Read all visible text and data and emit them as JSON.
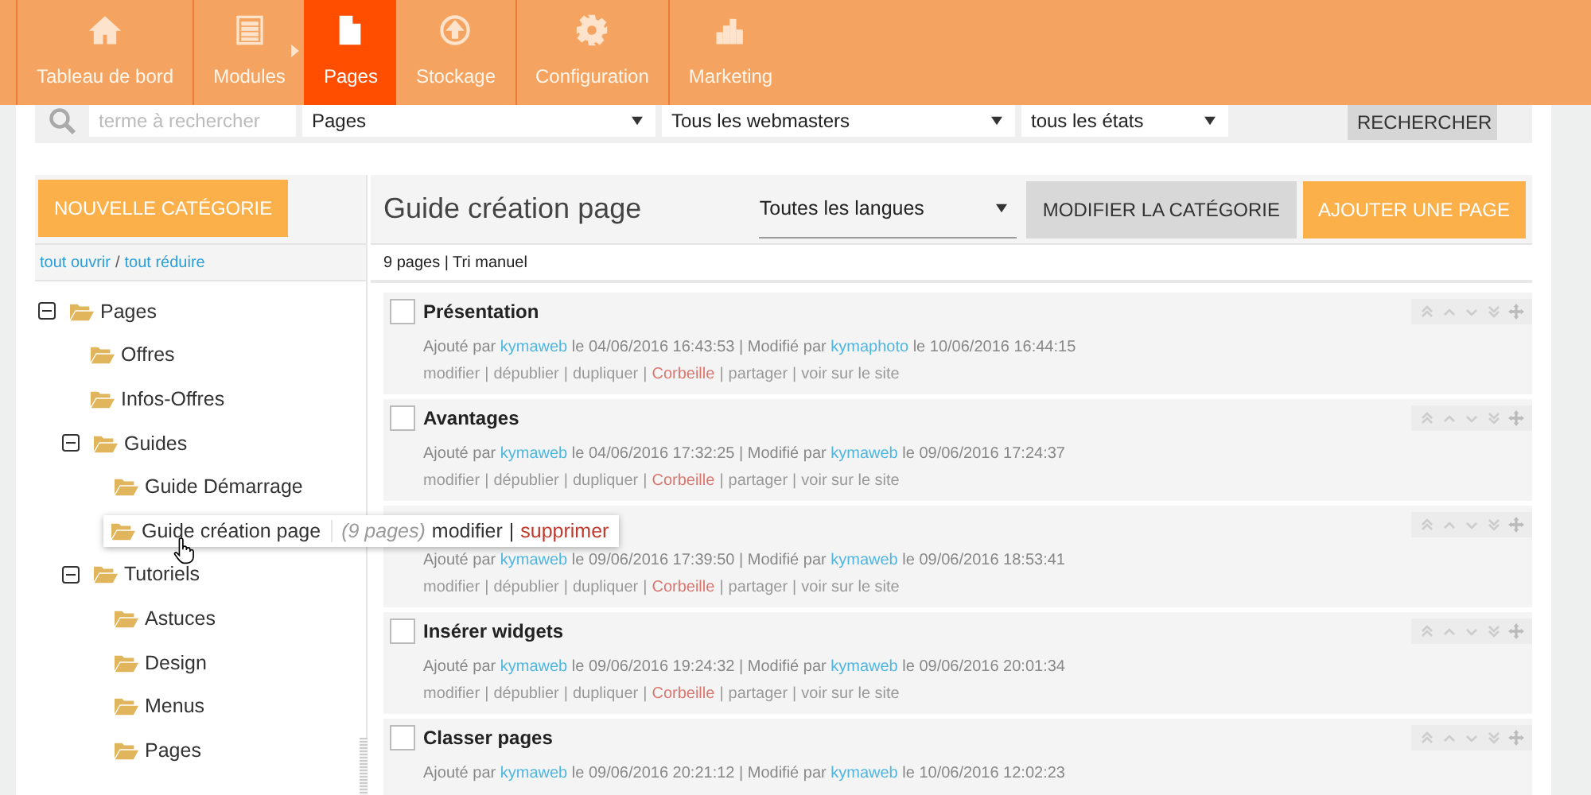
{
  "nav": [
    {
      "label": "Tableau de bord",
      "kind": "home",
      "selected": false,
      "submenu": false
    },
    {
      "label": "Modules",
      "kind": "list",
      "selected": false,
      "submenu": true
    },
    {
      "label": "Pages",
      "kind": "page",
      "selected": true,
      "submenu": false
    },
    {
      "label": "Stockage",
      "kind": "upload",
      "selected": false,
      "submenu": false
    },
    {
      "label": "Configuration",
      "kind": "gear",
      "selected": false,
      "submenu": false
    },
    {
      "label": "Marketing",
      "kind": "chart",
      "selected": false,
      "submenu": false
    }
  ],
  "search": {
    "placeholder": "terme à rechercher",
    "filters": [
      "Pages",
      "Tous les webmasters",
      "tous les états"
    ],
    "button": "RECHERCHER"
  },
  "sidebar": {
    "new_button": "NOUVELLE CATÉGORIE",
    "open_all": "tout ouvrir",
    "separator": "/",
    "collapse_all": "tout réduire",
    "tree": [
      {
        "label": "Pages",
        "expanded": true,
        "children": [
          {
            "label": "Offres"
          },
          {
            "label": "Infos-Offres"
          },
          {
            "label": "Guides",
            "expanded": true,
            "children": [
              {
                "label": "Guide Démarrage"
              },
              {
                "label": "Guide création page",
                "hovered": true,
                "count": "(9 pages)",
                "edit": "modifier",
                "separator": "|",
                "delete": "supprimer"
              }
            ]
          },
          {
            "label": "Tutoriels",
            "expanded": true,
            "children": [
              {
                "label": "Astuces"
              },
              {
                "label": "Design"
              },
              {
                "label": "Menus"
              },
              {
                "label": "Pages"
              }
            ]
          }
        ]
      }
    ]
  },
  "content": {
    "title": "Guide création page",
    "language": "Toutes les langues",
    "edit_button": "MODIFIER LA CATÉGORIE",
    "add_button": "AJOUTER UNE PAGE",
    "summary": "9 pages | Tri manuel",
    "action_separator": "|",
    "rows": [
      {
        "title": "Présentation",
        "checked": false,
        "added_label": "Ajouté par",
        "added_by": "kymaweb",
        "added_on": "le 04/06/2016 16:43:53 | Modifié par",
        "modified_by": "kymaphoto",
        "modified_on": "le 10/06/2016 16:44:15",
        "actions": [
          {
            "label": "modifier",
            "kind": "normal"
          },
          {
            "label": "dépublier",
            "kind": "normal"
          },
          {
            "label": "dupliquer",
            "kind": "normal"
          },
          {
            "label": "Corbeille",
            "kind": "danger"
          },
          {
            "label": "partager",
            "kind": "normal"
          },
          {
            "label": "voir sur le site",
            "kind": "normal"
          }
        ]
      },
      {
        "title": "Avantages",
        "checked": false,
        "added_label": "Ajouté par",
        "added_by": "kymaweb",
        "added_on": "le 04/06/2016 17:32:25 | Modifié par",
        "modified_by": "kymaweb",
        "modified_on": "le 09/06/2016 17:24:37",
        "actions": [
          {
            "label": "modifier",
            "kind": "normal"
          },
          {
            "label": "dépublier",
            "kind": "normal"
          },
          {
            "label": "dupliquer",
            "kind": "normal"
          },
          {
            "label": "Corbeille",
            "kind": "danger"
          },
          {
            "label": "partager",
            "kind": "normal"
          },
          {
            "label": "voir sur le site",
            "kind": "normal"
          }
        ]
      },
      {
        "added_label": "Ajouté par",
        "added_by": "kymaweb",
        "added_on": "le 09/06/2016 17:39:50 | Modifié par",
        "modified_by": "kymaweb",
        "modified_on": "le 09/06/2016 18:53:41",
        "actions": [
          {
            "label": "modifier",
            "kind": "normal"
          },
          {
            "label": "dépublier",
            "kind": "normal"
          },
          {
            "label": "dupliquer",
            "kind": "normal"
          },
          {
            "label": "Corbeille",
            "kind": "danger"
          },
          {
            "label": "partager",
            "kind": "normal"
          },
          {
            "label": "voir sur le site",
            "kind": "normal"
          }
        ]
      },
      {
        "title": "Insérer widgets",
        "checked": false,
        "added_label": "Ajouté par",
        "added_by": "kymaweb",
        "added_on": "le 09/06/2016 19:24:32 | Modifié par",
        "modified_by": "kymaweb",
        "modified_on": "le 09/06/2016 20:01:34",
        "actions": [
          {
            "label": "modifier",
            "kind": "normal"
          },
          {
            "label": "dépublier",
            "kind": "normal"
          },
          {
            "label": "dupliquer",
            "kind": "normal"
          },
          {
            "label": "Corbeille",
            "kind": "danger"
          },
          {
            "label": "partager",
            "kind": "normal"
          },
          {
            "label": "voir sur le site",
            "kind": "normal"
          }
        ]
      },
      {
        "title": "Classer pages",
        "checked": false,
        "added_label": "Ajouté par",
        "added_by": "kymaweb",
        "added_on": "le 09/06/2016 20:21:12 | Modifié par",
        "modified_by": "kymaweb",
        "modified_on": "le 10/06/2016 12:02:23"
      }
    ]
  }
}
